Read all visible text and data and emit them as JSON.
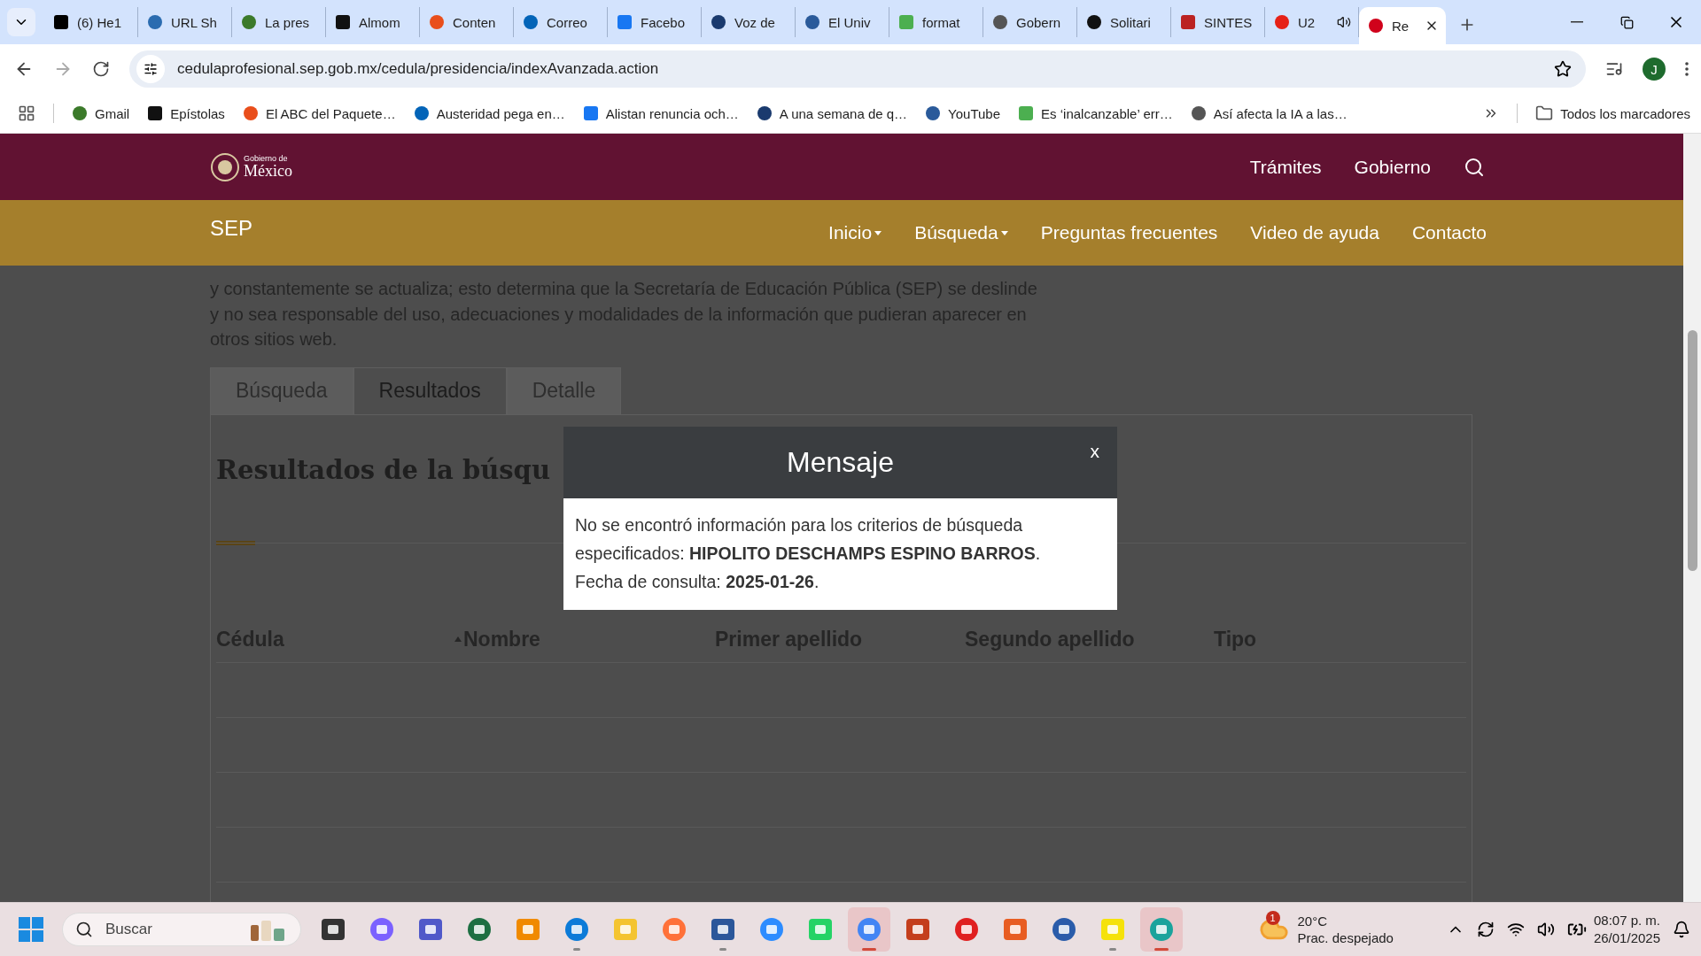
{
  "browser": {
    "tabs": [
      {
        "title": "(6) He1",
        "selected": false,
        "audible": false
      },
      {
        "title": "URL Sh",
        "selected": false,
        "audible": false
      },
      {
        "title": "La pres",
        "selected": false,
        "audible": false
      },
      {
        "title": "Almom",
        "selected": false,
        "audible": false
      },
      {
        "title": "Conten",
        "selected": false,
        "audible": false
      },
      {
        "title": "Correo",
        "selected": false,
        "audible": false
      },
      {
        "title": "Facebo",
        "selected": false,
        "audible": false
      },
      {
        "title": "Voz de",
        "selected": false,
        "audible": false
      },
      {
        "title": "El Univ",
        "selected": false,
        "audible": false
      },
      {
        "title": "format",
        "selected": false,
        "audible": false
      },
      {
        "title": "Gobern",
        "selected": false,
        "audible": false
      },
      {
        "title": "Solitari",
        "selected": false,
        "audible": false
      },
      {
        "title": "SINTES",
        "selected": false,
        "audible": false
      },
      {
        "title": "U2",
        "selected": false,
        "audible": true
      },
      {
        "title": "Re",
        "selected": true,
        "audible": false
      }
    ],
    "url": "cedulaprofesional.sep.gob.mx/cedula/presidencia/indexAvanzada.action",
    "profile_initial": "J",
    "bookmarks": [
      "Gmail",
      "Epístolas",
      "El ABC del Paquete…",
      "Austeridad pega en…",
      "Alistan renuncia och…",
      "A una semana de q…",
      "YouTube",
      "Es ‘inalcanzable’ err…",
      "Así afecta la IA a las…"
    ],
    "all_bookmarks": "Todos los marcadores"
  },
  "site": {
    "logo_small": "Gobierno de",
    "logo_big": "México",
    "top_links": [
      "Trámites",
      "Gobierno"
    ],
    "brand": "SEP",
    "nav": [
      {
        "label": "Inicio",
        "has_menu": true
      },
      {
        "label": "Búsqueda",
        "has_menu": true
      },
      {
        "label": "Preguntas frecuentes",
        "has_menu": false
      },
      {
        "label": "Video de ayuda",
        "has_menu": false
      },
      {
        "label": "Contacto",
        "has_menu": false
      }
    ],
    "intro": "y constantemente se actualiza; esto determina que la Secretaría de Educación Pública (SEP) se deslinde y no sea responsable del uso, adecuaciones y modalidades de la información que pudieran aparecer en otros sitios web.",
    "tabs": [
      {
        "label": "Búsqueda",
        "selected": false
      },
      {
        "label": "Resultados",
        "selected": true
      },
      {
        "label": "Detalle",
        "selected": false
      }
    ],
    "heading": "Resultados de la búsqu",
    "table": {
      "columns": [
        {
          "label": "Cédula",
          "sorted": false
        },
        {
          "label": "Nombre",
          "sorted": true
        },
        {
          "label": "Primer apellido",
          "sorted": false
        },
        {
          "label": "Segundo apellido",
          "sorted": false
        },
        {
          "label": "Tipo",
          "sorted": false
        }
      ]
    }
  },
  "dialog": {
    "title": "Mensaje",
    "close": "x",
    "lines": [
      "No se encontró información para los criterios de búsqueda especificados: **HIPOLITO DESCHAMPS ESPINO BARROS**.",
      "Fecha de consulta: **2025-01-26**."
    ]
  },
  "taskbar": {
    "search_placeholder": "Buscar",
    "apps": [
      {
        "running": false,
        "active": false
      },
      {
        "running": false,
        "active": false
      },
      {
        "running": false,
        "active": false
      },
      {
        "running": false,
        "active": false
      },
      {
        "running": false,
        "active": false
      },
      {
        "running": true,
        "active": false
      },
      {
        "running": false,
        "active": false
      },
      {
        "running": false,
        "active": false
      },
      {
        "running": true,
        "active": false
      },
      {
        "running": false,
        "active": false
      },
      {
        "running": false,
        "active": false
      },
      {
        "running": true,
        "active": true
      },
      {
        "running": false,
        "active": false
      },
      {
        "running": false,
        "active": false
      },
      {
        "running": false,
        "active": false
      },
      {
        "running": false,
        "active": false
      },
      {
        "running": true,
        "active": false
      },
      {
        "running": true,
        "active": true
      }
    ],
    "weather_badge": "1",
    "temperature": "20°C",
    "condition": "Prac. despejado",
    "time": "08:07 p. m.",
    "date": "26/01/2025"
  }
}
